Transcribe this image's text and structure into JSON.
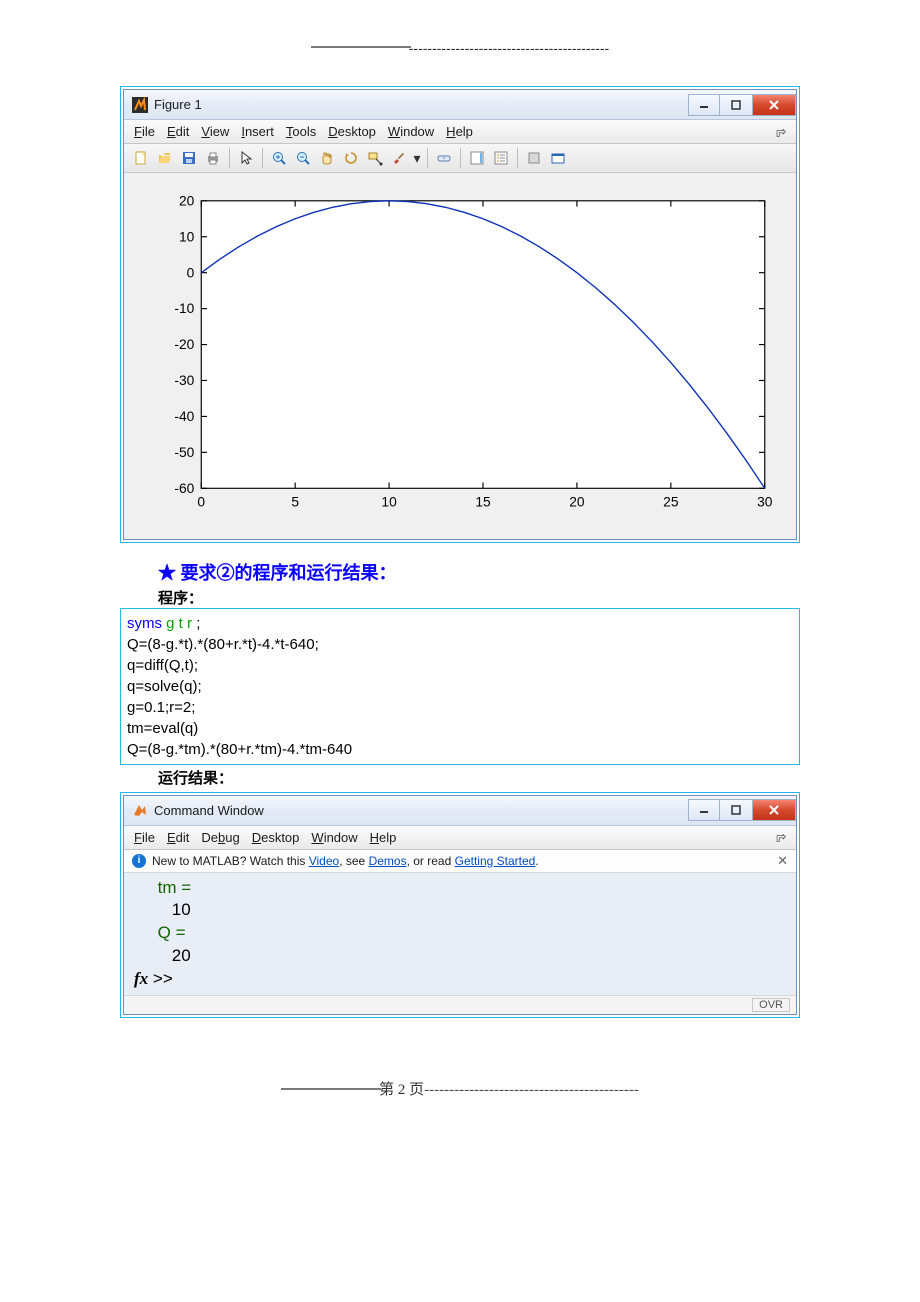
{
  "top_rule": "-------------------------------------------",
  "figure": {
    "title": "Figure 1",
    "menu": {
      "file": "File",
      "edit": "Edit",
      "view": "View",
      "insert": "Insert",
      "tools": "Tools",
      "desktop": "Desktop",
      "window": "Window",
      "help": "Help"
    },
    "toolbar_icons": [
      "new-file-icon",
      "open-icon",
      "save-icon",
      "print-icon",
      "pointer-icon",
      "zoom-in-icon",
      "zoom-out-icon",
      "pan-icon",
      "rotate-icon",
      "data-cursor-icon",
      "brush-icon",
      "link-icon",
      "colorbar-icon",
      "legend-icon",
      "hide-tools-icon",
      "dock-icon"
    ]
  },
  "chart_data": {
    "type": "line",
    "x": [
      0,
      1,
      2,
      3,
      4,
      5,
      6,
      7,
      8,
      9,
      10,
      11,
      12,
      13,
      14,
      15,
      16,
      17,
      18,
      19,
      20,
      21,
      22,
      23,
      24,
      25,
      26,
      27,
      28,
      29,
      30
    ],
    "y": [
      0.0,
      3.8,
      7.2,
      10.2,
      12.8,
      15.0,
      16.8,
      18.2,
      19.2,
      19.8,
      20.0,
      19.8,
      19.2,
      18.2,
      16.8,
      15.0,
      12.8,
      10.2,
      7.2,
      3.8,
      0.0,
      -4.2,
      -8.8,
      -13.8,
      -19.2,
      -25.0,
      -31.2,
      -37.8,
      -44.8,
      -52.2,
      -60.0
    ],
    "x_ticks": [
      0,
      5,
      10,
      15,
      20,
      25,
      30
    ],
    "y_ticks": [
      20,
      10,
      0,
      -10,
      -20,
      -30,
      -40,
      -50,
      -60
    ],
    "xlim": [
      0,
      30
    ],
    "ylim": [
      -60,
      20
    ]
  },
  "heading": "★ 要求②的程序和运行结果：",
  "code_label": "程序：",
  "code": {
    "l1a": "syms ",
    "l1b": "g t r ",
    "l1c": ";",
    "l2": "Q=(8-g.*t).*(80+r.*t)-4.*t-640;",
    "l3": "q=diff(Q,t);",
    "l4": "q=solve(q);",
    "l5": "g=0.1;r=2;",
    "l6": "tm=eval(q)",
    "l7": "Q=(8-g.*tm).*(80+r.*tm)-4.*tm-640"
  },
  "result_label": "运行结果：",
  "cmd": {
    "title": "Command Window",
    "menu": {
      "file": "File",
      "edit": "Edit",
      "debug": "Debug",
      "desktop": "Desktop",
      "window": "Window",
      "help": "Help"
    },
    "info_pre": "New to MATLAB? Watch this ",
    "info_video": "Video",
    "info_mid": ", see ",
    "info_demos": "Demos",
    "info_mid2": ", or read ",
    "info_getting": "Getting Started",
    "info_end": ".",
    "out_tm_label": "tm =",
    "out_tm_val": "10",
    "out_q_label": "Q =",
    "out_q_val": "20",
    "prompt": ">>",
    "status": "OVR"
  },
  "footer_text": "第 2 页",
  "footer_dashes": "-------------------------------------------"
}
